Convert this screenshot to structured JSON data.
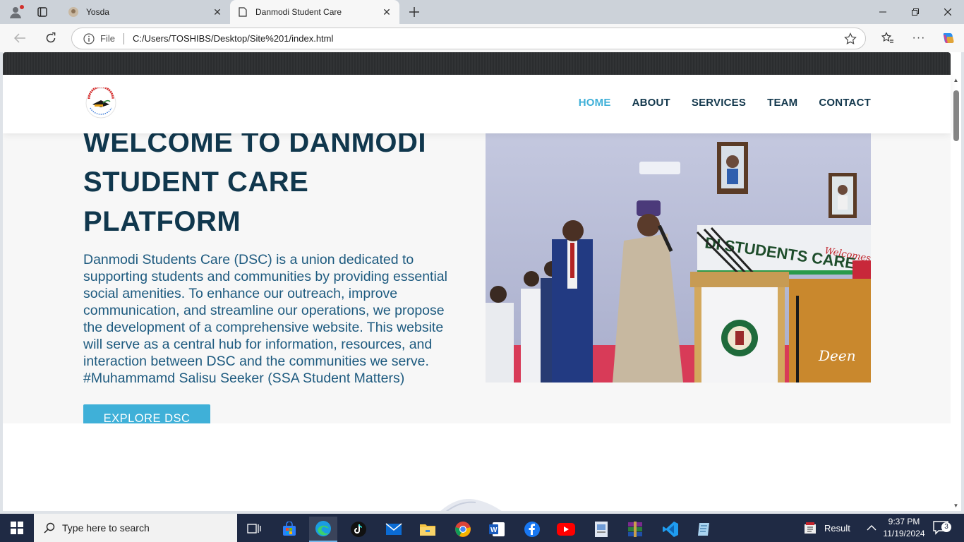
{
  "browser": {
    "tabs": [
      {
        "title": "Yosda",
        "active": false
      },
      {
        "title": "Danmodi Student Care",
        "active": true
      }
    ],
    "address": {
      "scheme": "File",
      "url": "C:/Users/TOSHIBS/Desktop/Site%201/index.html"
    },
    "new_tab_icon": "plus-icon"
  },
  "site": {
    "nav": [
      "HOME",
      "ABOUT",
      "SERVICES",
      "TEAM",
      "CONTACT"
    ],
    "active_nav": "HOME",
    "hero": {
      "title": "WELCOME TO DANMODI STUDENT CARE PLATFORM",
      "body": "Danmodi Students Care (DSC) is a union dedicated to supporting students and communities by providing essential social amenities. To enhance our outreach, improve communication, and streamline our operations, we propose the development of a comprehensive website. This website will serve as a central hub for information, resources, and interaction between DSC and the communities we serve. #Muhammamd Salisu Seeker (SSA Student Matters)",
      "cta": "EXPLORE DSC"
    },
    "photo_text": {
      "banner": "DI STUDENTS CARE",
      "script": "Welcomes You",
      "watermark": "Deen"
    },
    "colors": {
      "accent": "#3fb0d8",
      "heading": "#10374d",
      "body": "#1d5a7f"
    }
  },
  "taskbar": {
    "search_placeholder": "Type here to search",
    "tray_label": "Result",
    "time": "9:37 PM",
    "date": "11/19/2024",
    "notifications": "3"
  }
}
